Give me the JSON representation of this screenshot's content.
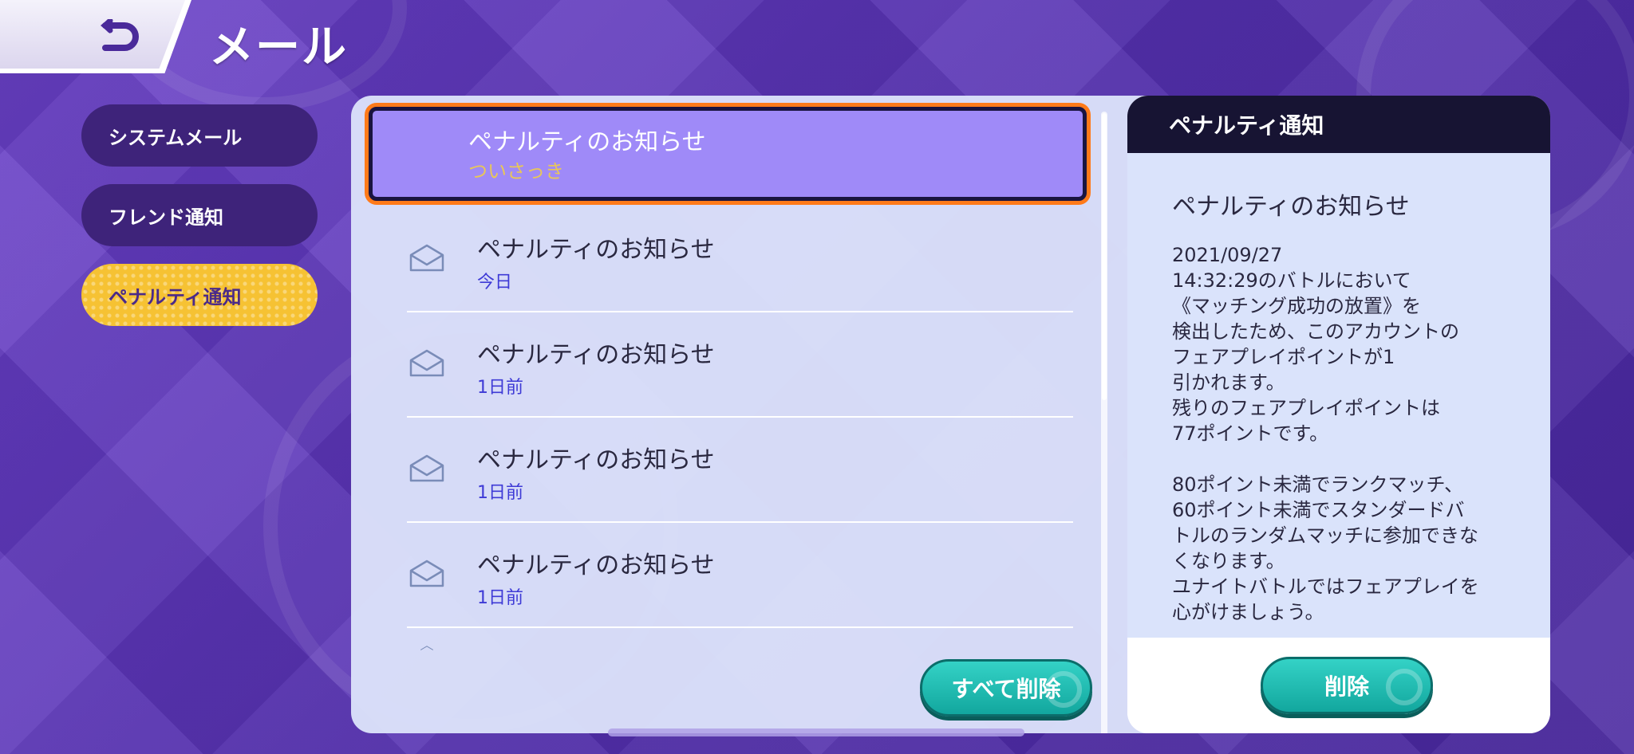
{
  "header": {
    "title": "メール",
    "back_icon": "back-arrow-icon"
  },
  "sidebar": {
    "items": [
      {
        "label": "システムメール",
        "active": false
      },
      {
        "label": "フレンド通知",
        "active": false
      },
      {
        "label": "ペナルティ通知",
        "active": true
      }
    ]
  },
  "mail_list": {
    "items": [
      {
        "title": "ペナルティのお知らせ",
        "time": "ついさっき",
        "selected": true
      },
      {
        "title": "ペナルティのお知らせ",
        "time": "今日",
        "selected": false
      },
      {
        "title": "ペナルティのお知らせ",
        "time": "1日前",
        "selected": false
      },
      {
        "title": "ペナルティのお知らせ",
        "time": "1日前",
        "selected": false
      },
      {
        "title": "ペナルティのお知らせ",
        "time": "1日前",
        "selected": false
      }
    ],
    "delete_all_label": "すべて削除"
  },
  "detail": {
    "header": "ペナルティ通知",
    "subject": "ペナルティのお知らせ",
    "body": "2021/09/27\n14:32:29のバトルにおいて\n《マッチング成功の放置》を\n検出したため、このアカウントの\nフェアプレイポイントが1\n引かれます。\n残りのフェアプレイポイントは\n77ポイントです。\n\n80ポイント未満でランクマッチ、\n60ポイント未満でスタンダードバ\nトルのランダムマッチに参加できな\nくなります。\nユナイトバトルではフェアプレイを\n心がけましょう。",
    "delete_label": "削除"
  },
  "colors": {
    "background": "#5a34b6",
    "sidebar_item": "#3e237a",
    "sidebar_active": "#f6c233",
    "selected_item": "#9f8af8",
    "selected_border": "#ff7a1a",
    "button": "#1fb9af",
    "time_text": "#3e3ad6",
    "detail_header": "#171433"
  }
}
